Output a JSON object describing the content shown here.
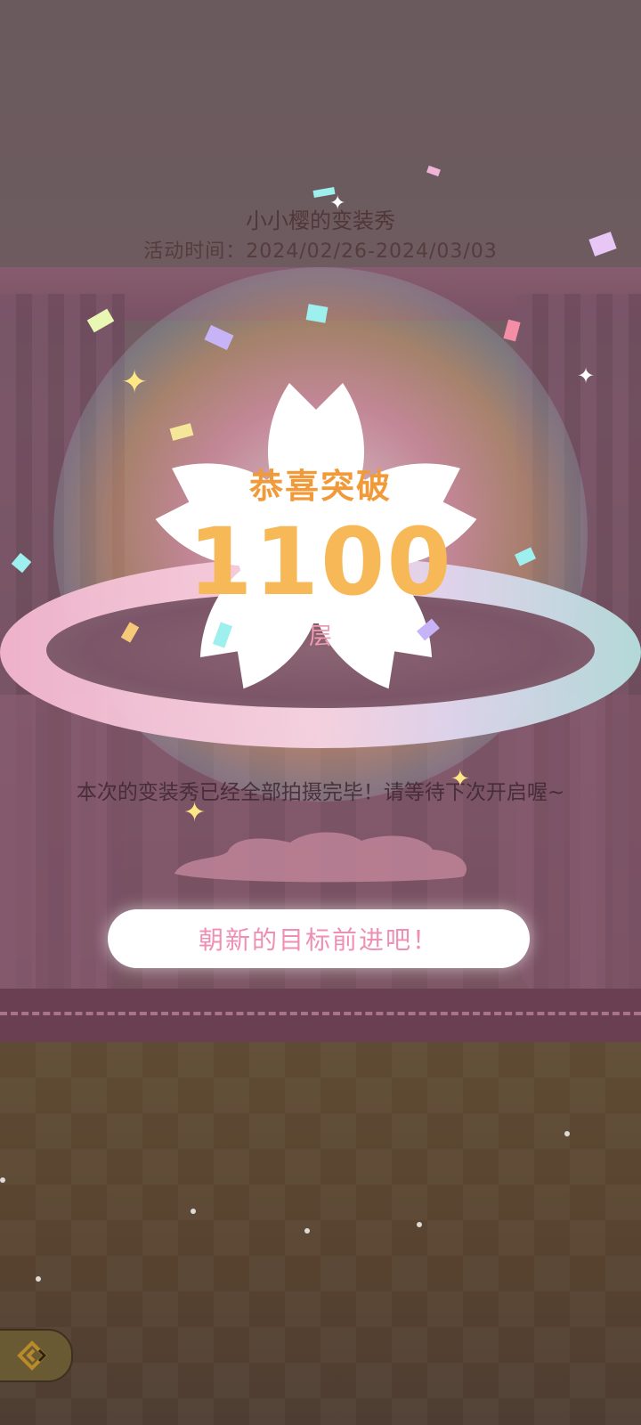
{
  "header": {
    "title": "小小樱的变装秀",
    "event_time": "活动时间：2024/02/26-2024/03/03"
  },
  "achievement": {
    "headline": "恭喜突破",
    "number": "1100",
    "unit": "层"
  },
  "message": "本次的变装秀已经全部拍摄完毕！请等待下次开启喔~",
  "cta": {
    "label": "朝新的目标前进吧！"
  },
  "nav": {
    "back_icon": "back-arrow-icon"
  },
  "colors": {
    "headline": "#f09a3a",
    "number": "#f7b957",
    "unit": "#ef9cb3",
    "cta_text": "#ee8fb3"
  }
}
